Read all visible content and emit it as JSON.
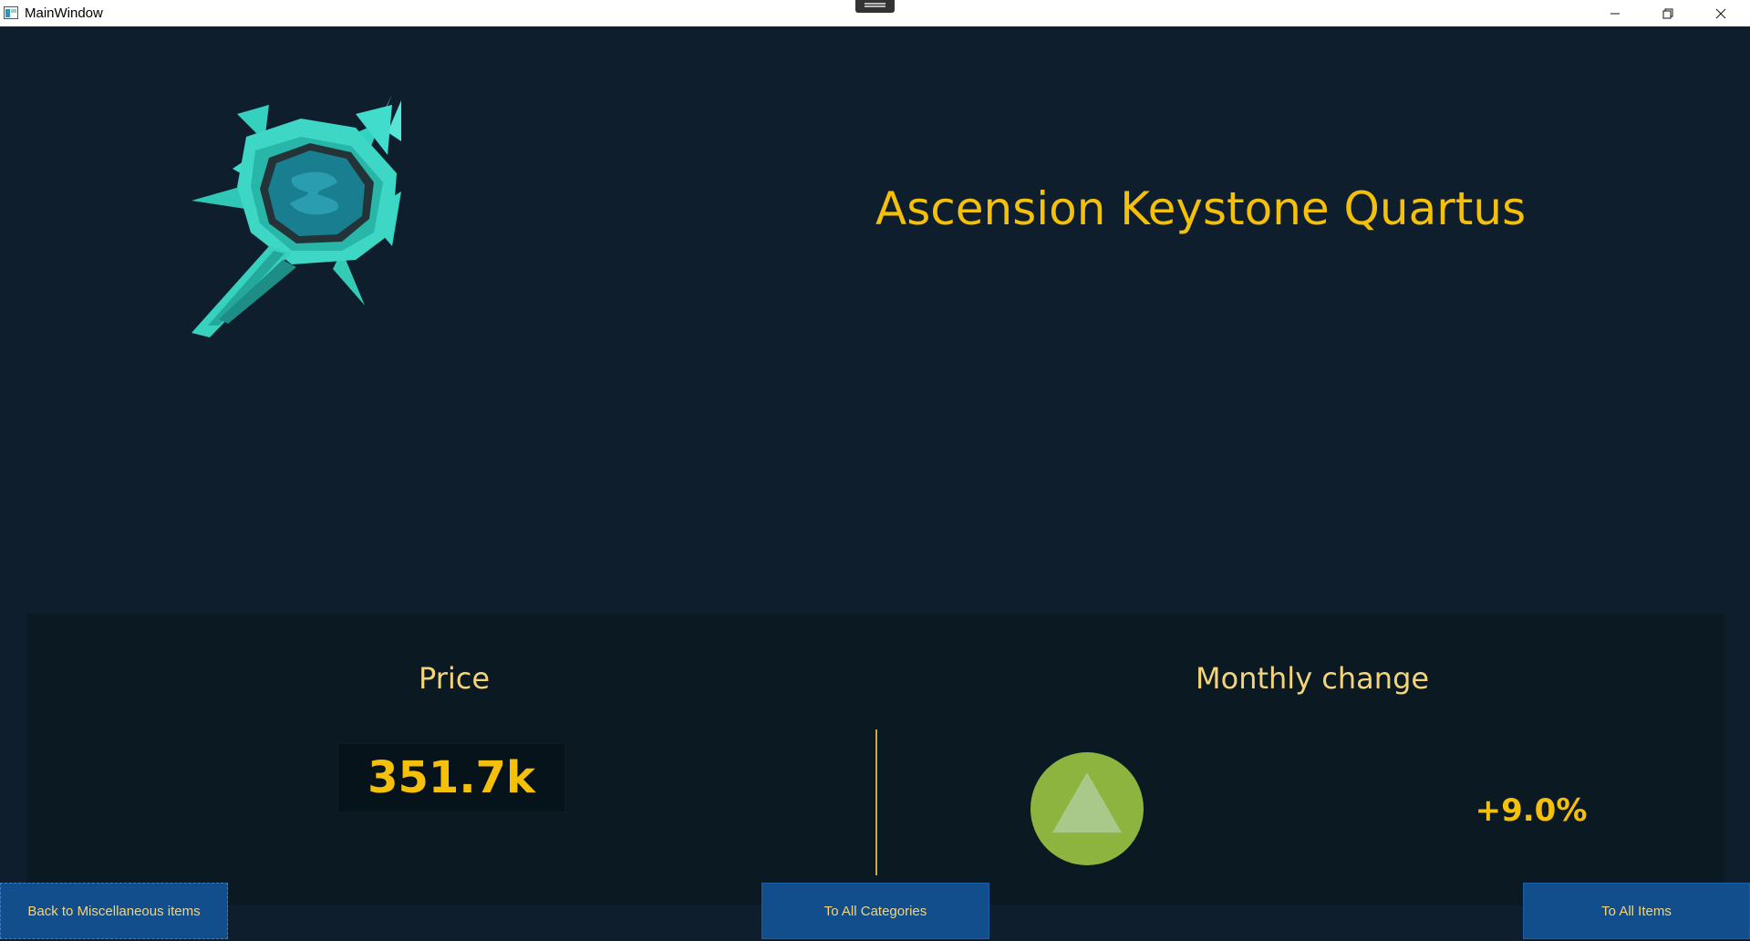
{
  "window": {
    "title": "MainWindow",
    "minimize_icon": "minimize-icon",
    "maximize_icon": "restore-icon",
    "close_icon": "close-icon"
  },
  "item": {
    "name": "Ascension Keystone Quartus",
    "image_icon": "crystal-keystone-icon"
  },
  "stats": {
    "price_label": "Price",
    "price_value": "351.7k",
    "change_label": "Monthly change",
    "change_value": "+9.0%",
    "trend_icon": "triangle-up-icon"
  },
  "nav": {
    "back_label": "Back to Miscellaneous items",
    "categories_label": "To All Categories",
    "items_label": "To All Items"
  },
  "colors": {
    "background": "#0f1e2d",
    "panel": "#0b1923",
    "accent_gold": "#f4c00a",
    "button_blue": "#124e8c",
    "trend_green": "#8db43f"
  }
}
